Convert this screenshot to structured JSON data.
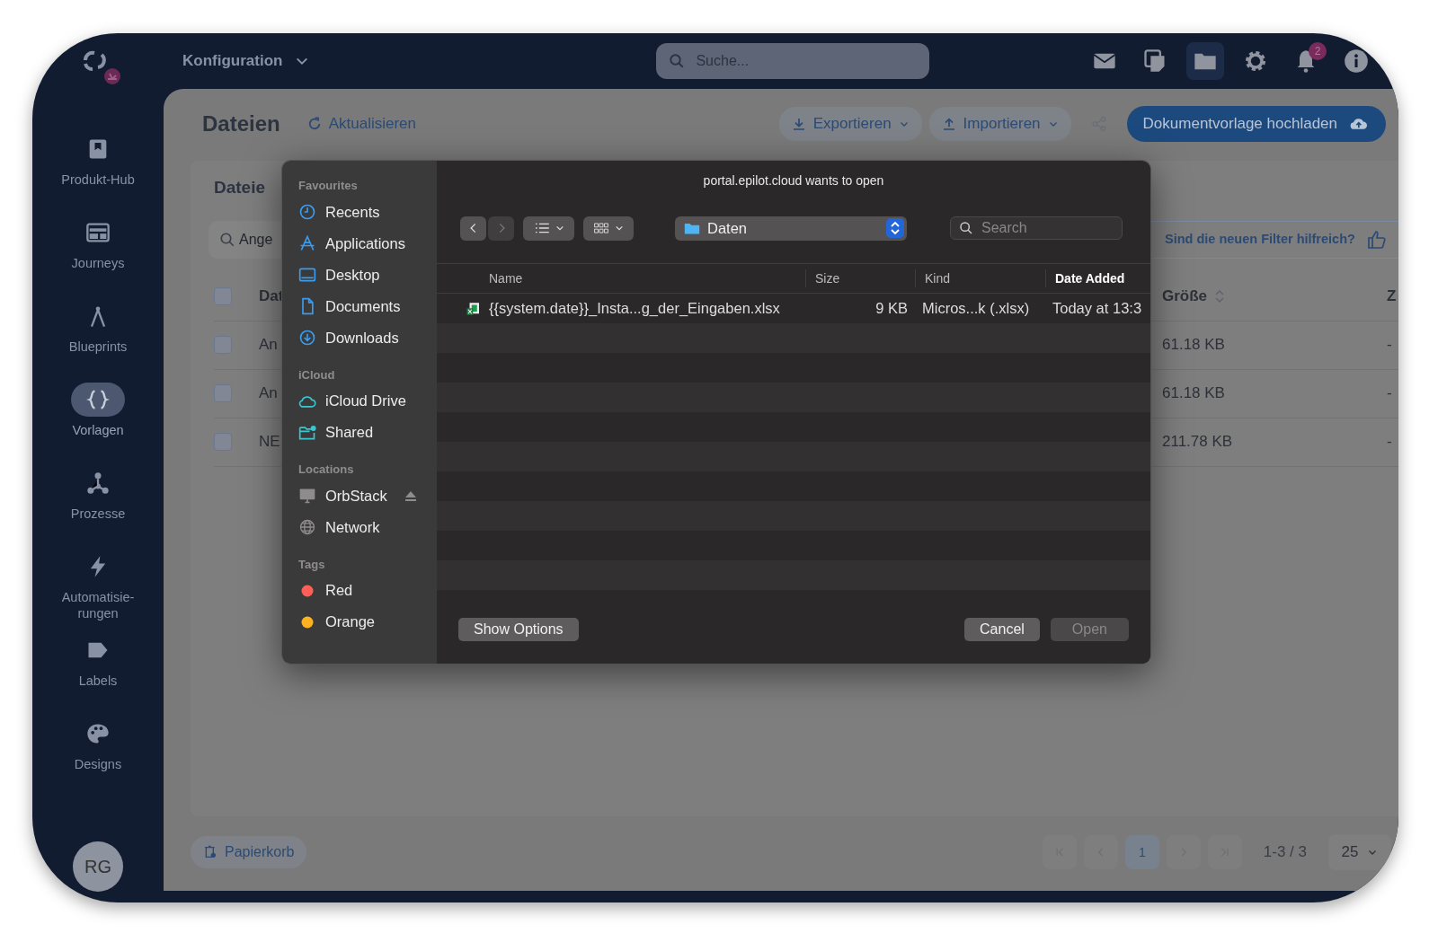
{
  "app_bar": {
    "menu": "Konfiguration",
    "search": {
      "placeholder": "Suche..."
    },
    "icons": [
      {
        "kind": "mail",
        "selected": false
      },
      {
        "kind": "notes",
        "selected": false
      },
      {
        "kind": "folder",
        "selected": true
      },
      {
        "kind": "settings",
        "selected": false
      },
      {
        "kind": "bell",
        "selected": false,
        "badge": "2"
      },
      {
        "kind": "info",
        "selected": false
      }
    ]
  },
  "sidebar": {
    "items": [
      {
        "kind": "hub",
        "label": "Produkt-Hub",
        "selected": false
      },
      {
        "kind": "journeys",
        "label": "Journeys",
        "selected": false
      },
      {
        "kind": "blueprints",
        "label": "Blueprints",
        "selected": false
      },
      {
        "kind": "templates",
        "label": "Vorlagen",
        "selected": true
      },
      {
        "kind": "processes",
        "label": "Prozesse",
        "selected": false
      },
      {
        "kind": "automation",
        "label": "Automatisie-\nrungen",
        "selected": false
      },
      {
        "kind": "labels",
        "label": "Labels",
        "selected": false
      },
      {
        "kind": "designs",
        "label": "Designs",
        "selected": false
      }
    ],
    "avatar": "RG"
  },
  "page": {
    "title": "Dateien",
    "refresh": "Aktualisieren",
    "export": "Exportieren",
    "import": "Importieren",
    "upload": "Dokumentvorlage hochladen"
  },
  "files_card": {
    "title": "Dateie",
    "search": {
      "placeholder": "Ange"
    },
    "feedback": "Sind die neuen Filter hilfreich?",
    "select_all": {
      "checked": false
    },
    "columns": [
      "Dat",
      "Größe",
      "Z"
    ],
    "rows": [
      {
        "name": "An",
        "size": "61.18 KB",
        "column_3": "-",
        "checked": false
      },
      {
        "name": "An",
        "size": "61.18 KB",
        "column_3": "-",
        "checked": false
      },
      {
        "name": "NE",
        "size": "211.78 KB",
        "column_3": "-",
        "checked": false
      }
    ]
  },
  "footer": {
    "trash": "Papierkorb",
    "pages": [
      {
        "label": "1",
        "selected": true
      }
    ],
    "range": "1-3 / 3",
    "page_size": "25"
  },
  "dialog": {
    "title": "portal.epilot.cloud wants to open",
    "sections": [
      {
        "title": "Favourites",
        "items": [
          {
            "kind": "clock",
            "label": "Recents"
          },
          {
            "kind": "apps",
            "label": "Applications"
          },
          {
            "kind": "desktop",
            "label": "Desktop"
          },
          {
            "kind": "document",
            "label": "Documents"
          },
          {
            "kind": "download",
            "label": "Downloads"
          }
        ]
      },
      {
        "title": "iCloud",
        "items": [
          {
            "kind": "cloud",
            "label": "iCloud Drive"
          },
          {
            "kind": "shared",
            "label": "Shared"
          }
        ]
      },
      {
        "title": "Locations",
        "items": [
          {
            "kind": "computer",
            "label": "OrbStack",
            "eject": true
          },
          {
            "kind": "globe",
            "label": "Network"
          }
        ]
      },
      {
        "title": "Tags",
        "items": [
          {
            "kind": "tag",
            "label": "Red",
            "color": "#ff5f57"
          },
          {
            "kind": "tag",
            "label": "Orange",
            "color": "#ffb21f"
          }
        ]
      }
    ],
    "back": {
      "disabled": false
    },
    "forward": {
      "disabled": true
    },
    "location": "Daten",
    "search": {
      "placeholder": "Search"
    },
    "columns": [
      {
        "label": "Name",
        "sorted": false
      },
      {
        "label": "Size",
        "sorted": false
      },
      {
        "label": "Kind",
        "sorted": false
      },
      {
        "label": "Date Added",
        "sorted": true
      }
    ],
    "files": [
      {
        "name": "{{system.date}}_Insta...g_der_Eingaben.xlsx",
        "size": "9 KB",
        "kind": "Micros...k (.xlsx)",
        "date_added": "Today at 13:3"
      }
    ],
    "buttons": [
      {
        "label": "Show Options",
        "disabled": false
      },
      {
        "label": "Cancel",
        "disabled": false
      },
      {
        "label": "Open",
        "disabled": true
      }
    ]
  }
}
